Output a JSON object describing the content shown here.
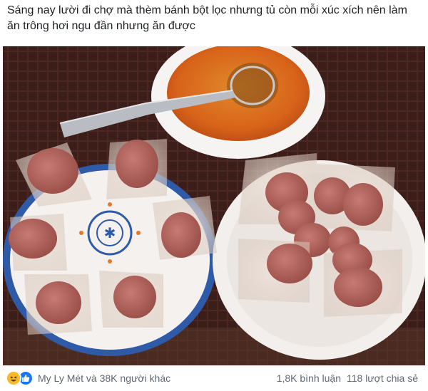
{
  "post": {
    "caption": "Sáng nay lười đi chợ mà thèm bánh bột lọc nhưng tủ còn mỗi xúc xích nên làm ăn trông hơi ngu đần nhưng ăn được"
  },
  "photo": {
    "subject": "bánh bột lọc xúc xích"
  },
  "footer": {
    "reactions_label": "My Ly Mét và 38K người khác",
    "comments": "1,8K bình luận",
    "shares": "118 lượt chia sẻ"
  },
  "icons": {
    "haha": "haha-react-icon",
    "like": "like-react-icon"
  },
  "colors": {
    "like_blue": "#1877f2",
    "haha_yellow": "#f7b928",
    "text_secondary": "#606770"
  }
}
